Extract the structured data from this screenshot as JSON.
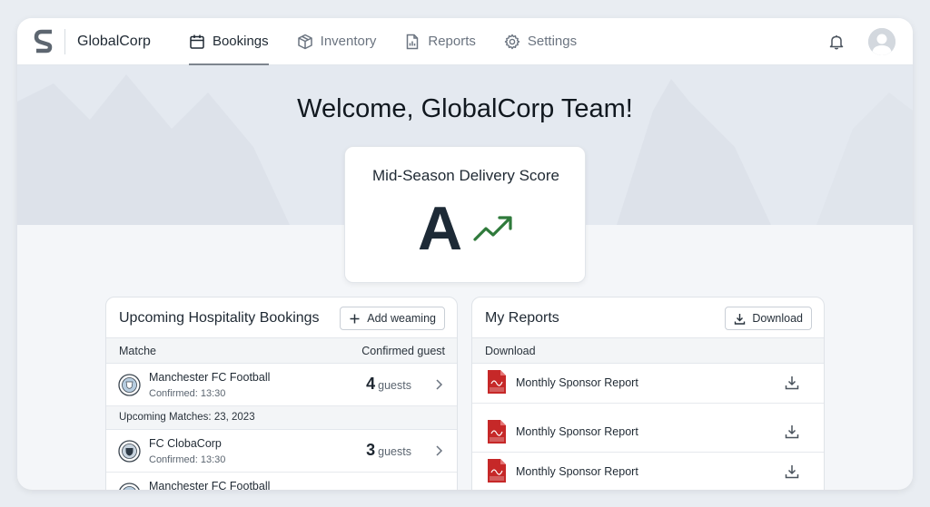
{
  "header": {
    "brand": "GlobalCorp",
    "nav": [
      {
        "label": "Bookings",
        "icon": "calendar-icon",
        "active": true
      },
      {
        "label": "Inventory",
        "icon": "box-icon",
        "active": false
      },
      {
        "label": "Reports",
        "icon": "report-icon",
        "active": false
      },
      {
        "label": "Settings",
        "icon": "gear-icon",
        "active": false
      }
    ]
  },
  "hero": {
    "welcome": "Welcome, GlobalCorp Team!"
  },
  "score": {
    "title": "Mid-Season Delivery Score",
    "grade": "A",
    "trend_color": "#2f7a3b"
  },
  "bookings": {
    "title": "Upcoming Hospitality Bookings",
    "add_label": "Add weaming",
    "col_match": "Matche",
    "col_guests": "Confirmed guest",
    "rows": [
      {
        "name": "Manchester FC Football",
        "sub": "Confirmed: 13:30",
        "count": "4",
        "unit": "guests"
      },
      {
        "name": "FC ClobaCorp",
        "sub": "Confirmed: 13:30",
        "count": "3",
        "unit": "guests"
      },
      {
        "name": "Manchester FC Football",
        "sub": "",
        "count": "",
        "unit": ""
      }
    ],
    "section_label": "Upcoming Matches: 23, 2023"
  },
  "reports": {
    "title": "My Reports",
    "download_label": "Download",
    "col_download": "Download",
    "rows": [
      {
        "name": "Monthly Sponsor Report"
      },
      {
        "name": "Monthly Sponsor Report"
      },
      {
        "name": "Monthly Sponsor Report"
      }
    ]
  },
  "colors": {
    "accent": "#1d2a36",
    "pdf_red": "#c62828"
  }
}
